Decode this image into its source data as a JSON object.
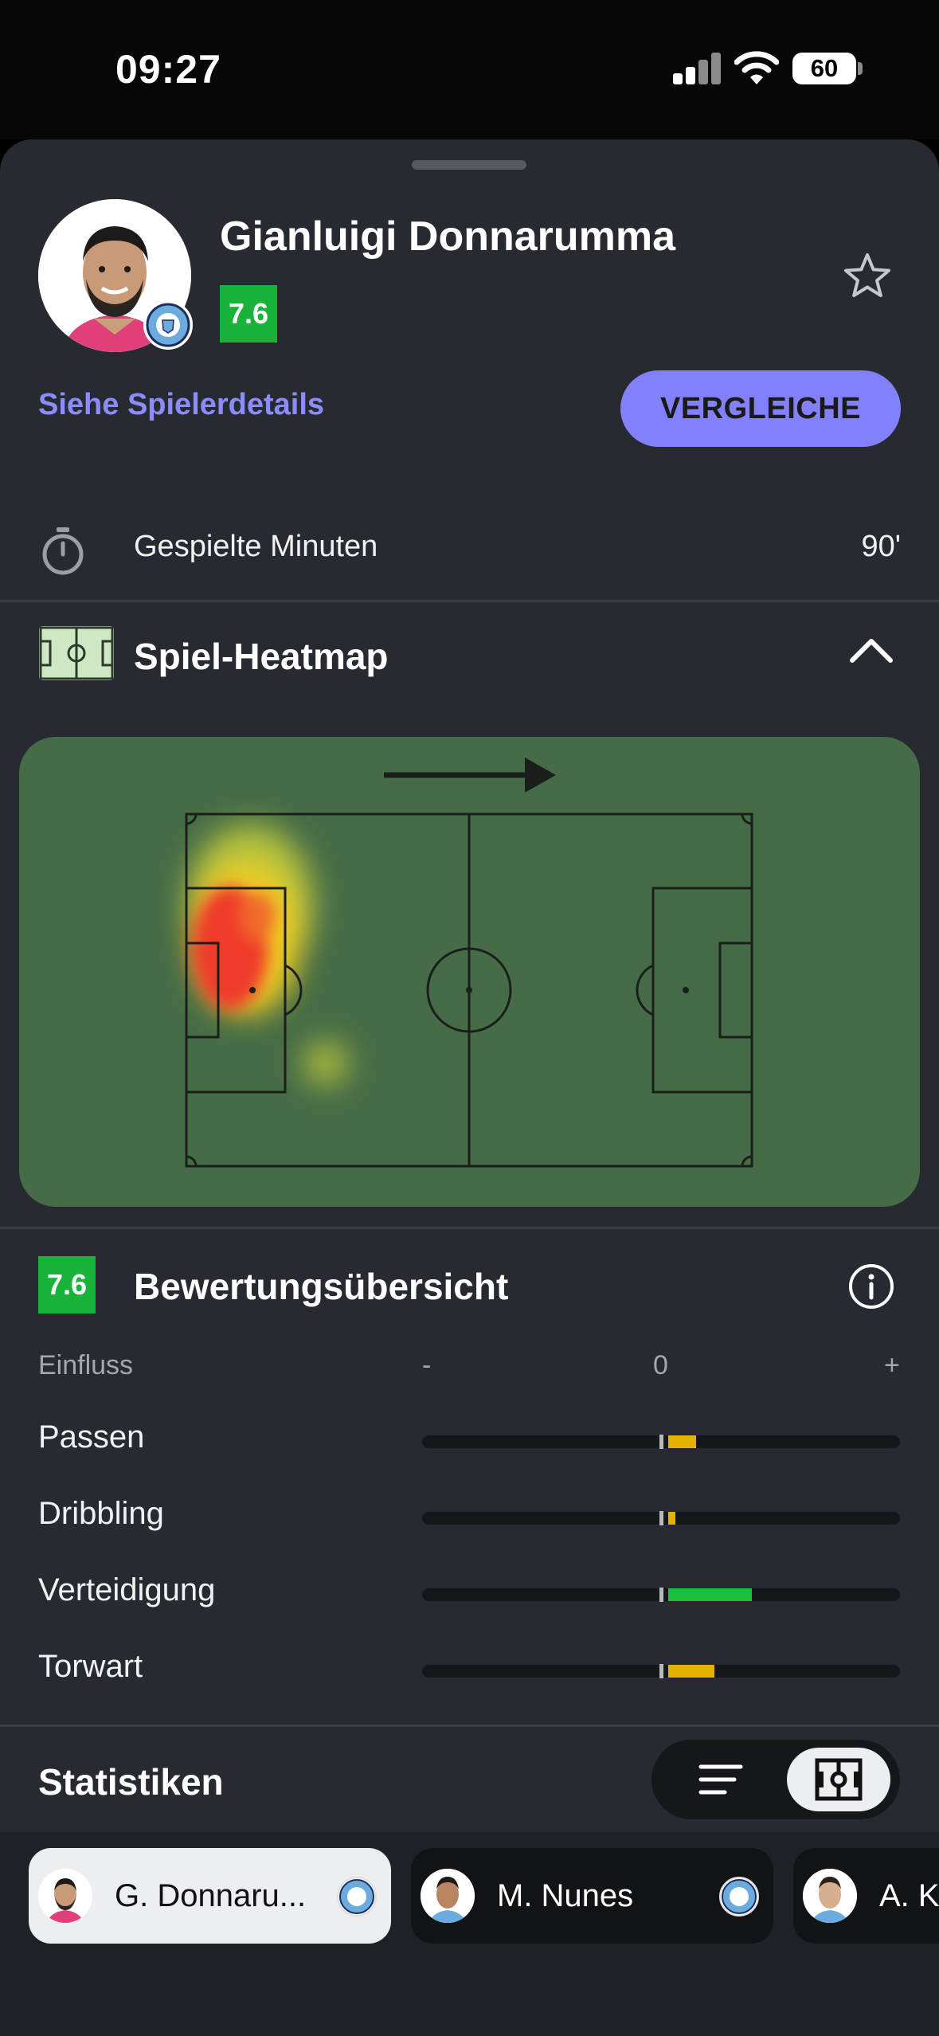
{
  "status_bar": {
    "time": "09:27",
    "battery": "60"
  },
  "player": {
    "name": "Gianluigi Donnarumma",
    "rating": "7.6",
    "details_link": "Siehe Spielerdetails",
    "compare_button": "VERGLEICHE"
  },
  "minutes": {
    "label": "Gespielte Minuten",
    "value": "90'"
  },
  "heatmap": {
    "title": "Spiel-Heatmap"
  },
  "rating_overview": {
    "badge": "7.6",
    "title": "Bewertungsübersicht",
    "scale": {
      "label": "Einfluss",
      "minus": "-",
      "zero": "0",
      "plus": "+"
    },
    "metrics": [
      {
        "label": "Passen",
        "value": 0.06,
        "color": "#e6b000"
      },
      {
        "label": "Dribbling",
        "value": 0.015,
        "color": "#e6b000"
      },
      {
        "label": "Verteidigung",
        "value": 0.18,
        "color": "#19c23a"
      },
      {
        "label": "Torwart",
        "value": 0.1,
        "color": "#e6b000"
      }
    ]
  },
  "stats": {
    "title": "Statistiken"
  },
  "player_tabs": [
    {
      "name": "G. Donnaru...",
      "active": true
    },
    {
      "name": "M. Nunes",
      "active": false
    },
    {
      "name": "A. Kh",
      "active": false
    }
  ]
}
